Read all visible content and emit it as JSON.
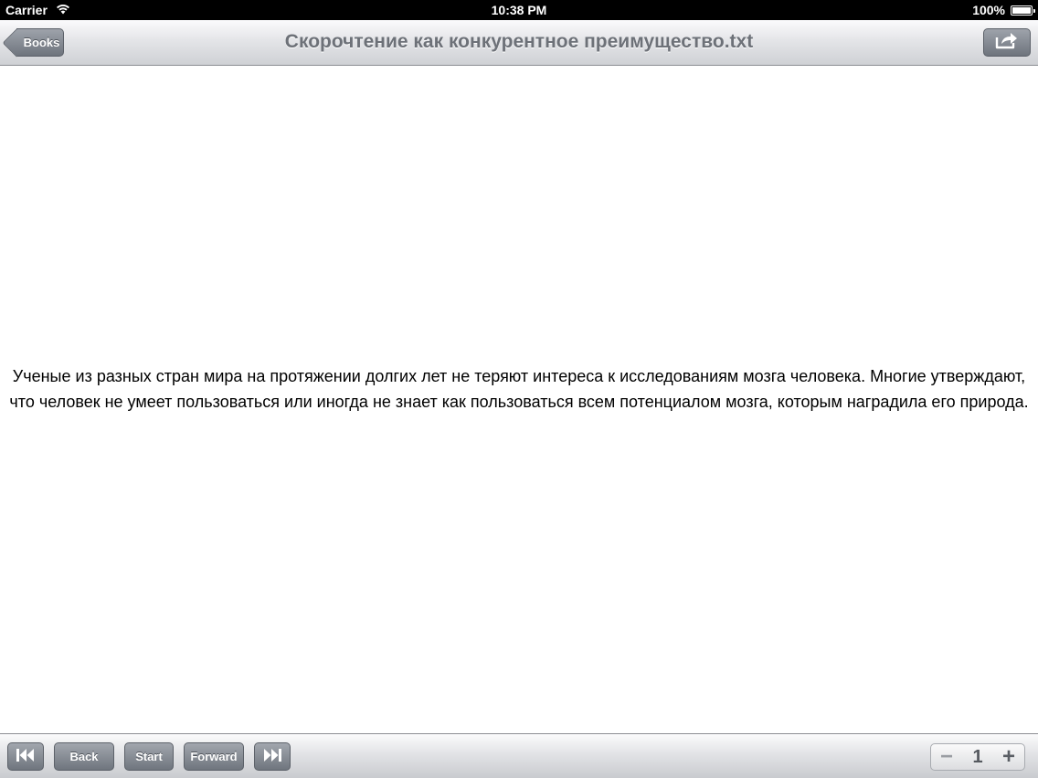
{
  "status_bar": {
    "carrier": "Carrier",
    "time": "10:38 PM",
    "battery": "100%"
  },
  "nav": {
    "back_label": "Books",
    "title": "Скорочтение как конкурентное преимущество.txt"
  },
  "content": {
    "text": "Ученые из разных стран мира на протяжении долгих лет не теряют интереса к исследованиям мозга человека. Многие утверждают, что человек не умеет пользоваться или иногда не знает как пользоваться всем потенциалом мозга, которым наградила его природа."
  },
  "toolbar": {
    "back_label": "Back",
    "start_label": "Start",
    "forward_label": "Forward",
    "stepper": {
      "minus": "−",
      "value": "1",
      "plus": "+"
    }
  },
  "icons": {
    "wifi": "wifi-icon",
    "battery": "battery-icon",
    "share": "share-icon",
    "skip_first": "skip-to-first-icon",
    "skip_last": "skip-to-last-icon"
  },
  "colors": {
    "title": "#6d7178",
    "button": "#7d838b",
    "status_bar": "#000000"
  }
}
